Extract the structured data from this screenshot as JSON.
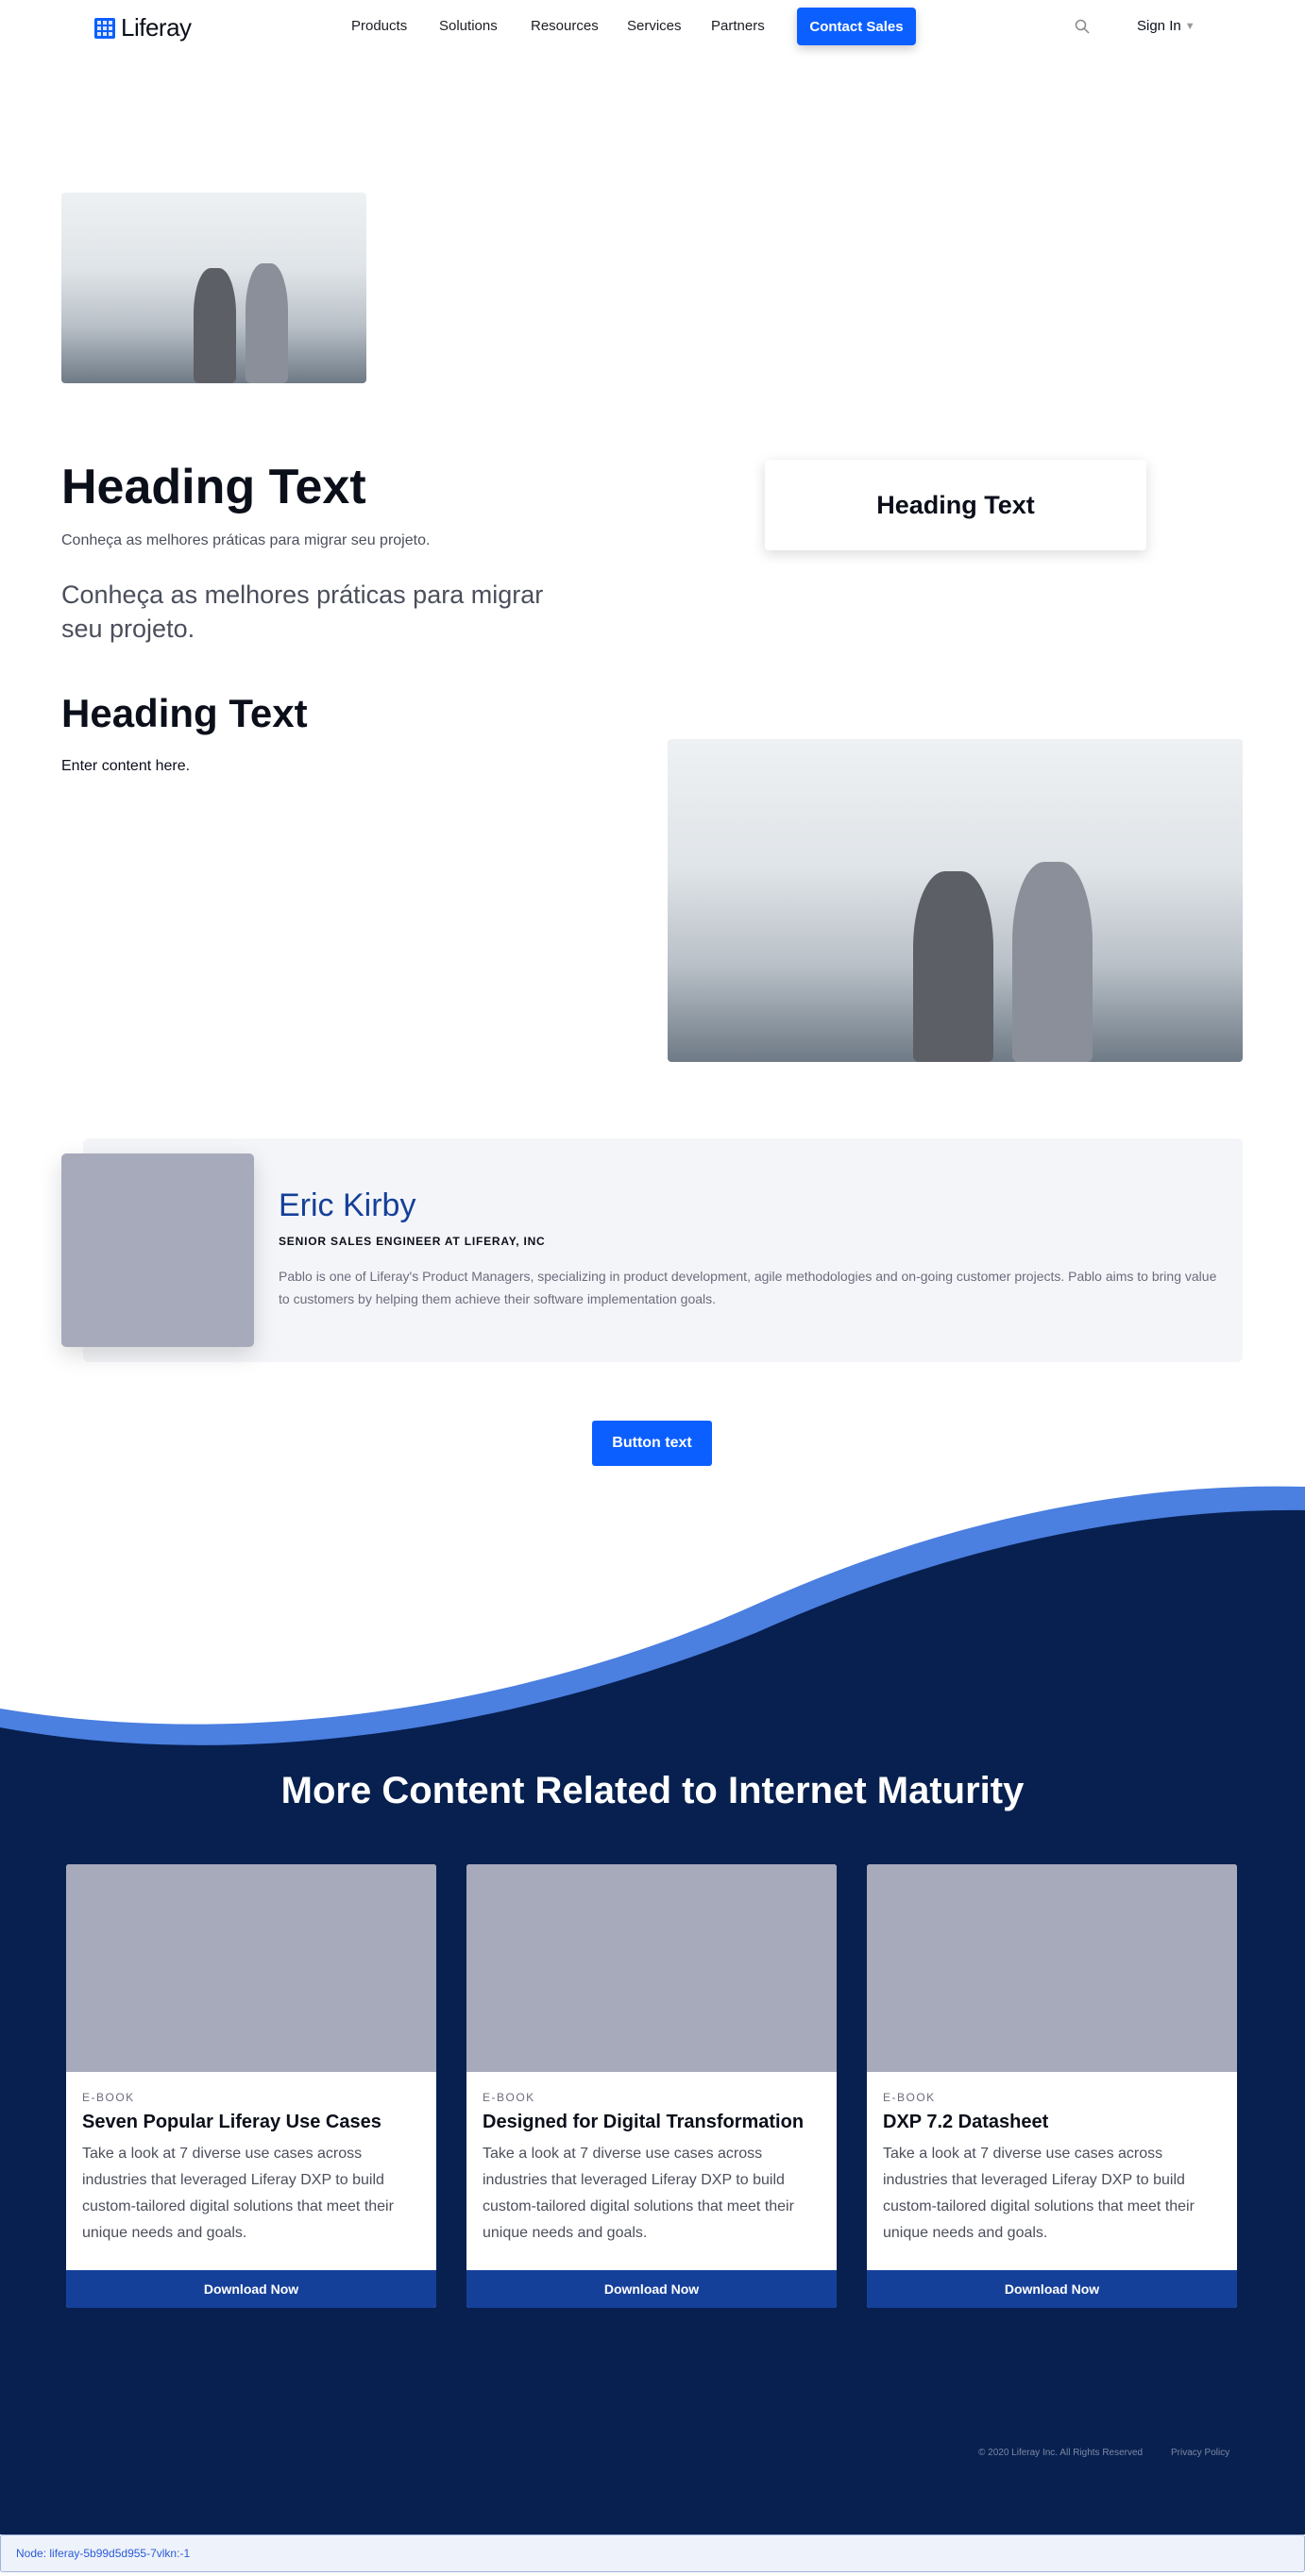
{
  "nav": {
    "logo": "Liferay",
    "items": [
      "Products",
      "Solutions",
      "Resources",
      "Services",
      "Partners"
    ],
    "contact": "Contact Sales",
    "sign_in": "Sign In"
  },
  "main": {
    "heading1": "Heading Text",
    "subtitle_small": "Conheça as melhores práticas para migrar seu projeto.",
    "subtitle_large": "Conheça as melhores práticas para migrar seu projeto.",
    "card_heading": "Heading Text",
    "heading2": "Heading Text",
    "content": "Enter content here."
  },
  "profile": {
    "name": "Eric Kirby",
    "title": "SENIOR SALES ENGINEER AT LIFERAY, INC",
    "bio": "Pablo is one of Liferay's Product Managers, specializing in product development, agile methodologies and on-going customer projects. Pablo aims to bring value to customers by helping them achieve their software implementation goals."
  },
  "button": "Button text",
  "related": {
    "title": "More Content Related to Internet Maturity",
    "cards": [
      {
        "tag": "E-BOOK",
        "title": "Seven Popular Liferay Use Cases",
        "desc": "Take a look at 7 diverse use cases across industries that leveraged Liferay DXP to build custom-tailored digital solutions that meet their unique needs and goals.",
        "cta": "Download Now"
      },
      {
        "tag": "E-BOOK",
        "title": "Designed for Digital Transformation",
        "desc": "Take a look at 7 diverse use cases across industries that leveraged Liferay DXP to build custom-tailored digital solutions that meet their unique needs and goals.",
        "cta": "Download Now"
      },
      {
        "tag": "E-BOOK",
        "title": "DXP 7.2 Datasheet",
        "desc": "Take a look at 7 diverse use cases across industries that leveraged Liferay DXP to build custom-tailored digital solutions that meet their unique needs and goals.",
        "cta": "Download Now"
      }
    ]
  },
  "footer": {
    "copyright": "© 2020 Liferay Inc. All Rights Reserved",
    "privacy": "Privacy Policy"
  },
  "node": "Node: liferay-5b99d5d955-7vlkn:-1",
  "colors": {
    "primary": "#0b5fff",
    "navy": "#07204f",
    "wave": "#4b7fe0",
    "card_button": "#15409a"
  }
}
